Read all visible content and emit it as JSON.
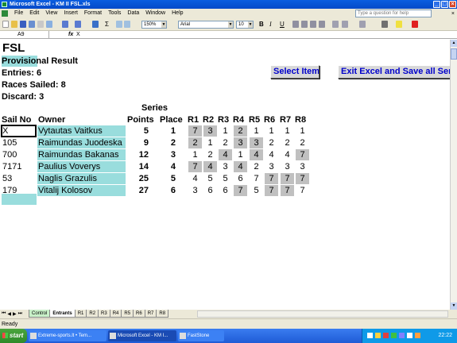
{
  "window": {
    "title": "Microsoft Excel - KM II FSL.xls"
  },
  "menu": {
    "items": [
      "File",
      "Edit",
      "View",
      "Insert",
      "Format",
      "Tools",
      "Data",
      "Window",
      "Help"
    ],
    "help_placeholder": "Type a question for help",
    "close_glyph": "×"
  },
  "toolbar": {
    "zoom": "150%",
    "font_name": "Arial",
    "font_size": "10",
    "bold": "B",
    "italic": "I",
    "underline": "U",
    "sigma": "Σ"
  },
  "formula_bar": {
    "name_box": "A9",
    "fx": "fx",
    "value": "X"
  },
  "sheet": {
    "title": "FSL",
    "provisional": "Provisional Result",
    "entries": "Entries: 6",
    "races_sailed": "Races Sailed: 8",
    "discard": "Discard: 3",
    "select_item_button": "Select Item",
    "exit_button": "Exit Excel and Save all Sen",
    "series_header": "Series",
    "headers": {
      "sail_no": "Sail No",
      "owner": "Owner",
      "points": "Points",
      "place": "Place",
      "races": [
        "R1",
        "R2",
        "R3",
        "R4",
        "R5",
        "R6",
        "R7",
        "R8"
      ]
    },
    "rows": [
      {
        "sail": "X",
        "owner": "Vytautas Vaitkus",
        "points": "5",
        "place": "1",
        "r": [
          "7",
          "3",
          "1",
          "2",
          "1",
          "1",
          "1",
          "1"
        ],
        "d": [
          1,
          1,
          0,
          1,
          0,
          0,
          0,
          0
        ]
      },
      {
        "sail": "105",
        "owner": "Raimundas Juodeska",
        "points": "9",
        "place": "2",
        "r": [
          "2",
          "1",
          "2",
          "3",
          "3",
          "2",
          "2",
          "2"
        ],
        "d": [
          1,
          0,
          0,
          1,
          1,
          0,
          0,
          0
        ]
      },
      {
        "sail": "700",
        "owner": "Raimundas Bakanas",
        "points": "12",
        "place": "3",
        "r": [
          "1",
          "2",
          "4",
          "1",
          "4",
          "4",
          "4",
          "7"
        ],
        "d": [
          0,
          0,
          1,
          0,
          1,
          0,
          0,
          1
        ]
      },
      {
        "sail": "7171",
        "owner": "Paulius Voverys",
        "points": "14",
        "place": "4",
        "r": [
          "7",
          "4",
          "3",
          "4",
          "2",
          "3",
          "3",
          "3"
        ],
        "d": [
          1,
          1,
          0,
          1,
          0,
          0,
          0,
          0
        ]
      },
      {
        "sail": "53",
        "owner": "Naglis Grazulis",
        "points": "25",
        "place": "5",
        "r": [
          "4",
          "5",
          "5",
          "6",
          "7",
          "7",
          "7",
          "7"
        ],
        "d": [
          0,
          0,
          0,
          0,
          0,
          1,
          1,
          1
        ]
      },
      {
        "sail": "179",
        "owner": "Vitalij Kolosov",
        "points": "27",
        "place": "6",
        "r": [
          "3",
          "6",
          "6",
          "7",
          "5",
          "7",
          "7",
          "7"
        ],
        "d": [
          0,
          0,
          0,
          1,
          0,
          1,
          1,
          0
        ]
      }
    ]
  },
  "tabs": {
    "nav": [
      "⏮",
      "◀",
      "▶",
      "⏭"
    ],
    "items": [
      "Control",
      "Entrants",
      "R1",
      "R2",
      "R3",
      "R4",
      "R5",
      "R6",
      "R7",
      "R8"
    ],
    "active": "Entrants"
  },
  "status": {
    "text": "Ready"
  },
  "taskbar": {
    "start": "start",
    "tasks": [
      {
        "label": "Extreme-sports.lt • Tem...",
        "active": false
      },
      {
        "label": "Microsoft Excel - KM I...",
        "active": true
      },
      {
        "label": "FastStone",
        "active": false
      }
    ],
    "clock": "22:22"
  },
  "colors": {
    "highlight_teal": "#99dddd",
    "discard_grey": "#c0c0c0",
    "button_text": "#0000cc"
  }
}
